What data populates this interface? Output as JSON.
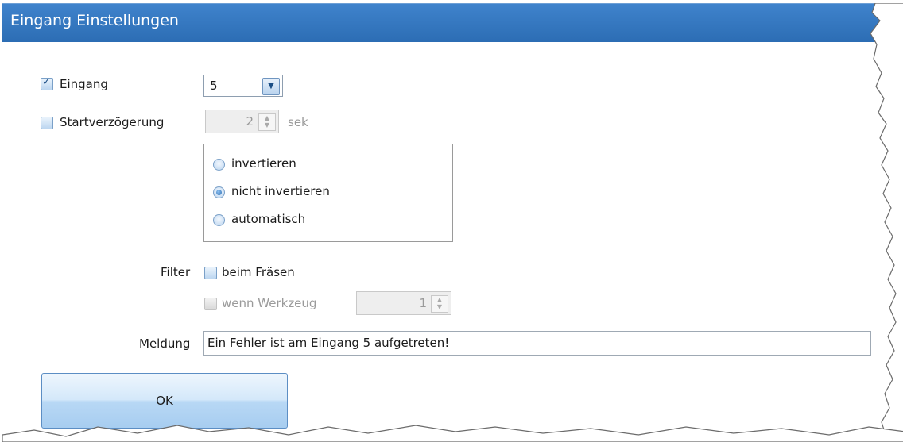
{
  "window": {
    "title": "Eingang Einstellungen"
  },
  "input": {
    "checkbox_label": "Eingang",
    "checked": true,
    "selected_value": "5"
  },
  "start_delay": {
    "checkbox_label": "Startverzögerung",
    "checked": false,
    "value": "2",
    "unit": "sek"
  },
  "invert_options": {
    "options": [
      "invertieren",
      "nicht invertieren",
      "automatisch"
    ],
    "selected": "nicht invertieren"
  },
  "filter": {
    "label": "Filter",
    "milling_label": "beim Fräsen",
    "milling_checked": false,
    "tool_label": "wenn Werkzeug",
    "tool_checked": false,
    "tool_value": "1"
  },
  "message": {
    "label": "Meldung",
    "value": "Ein Fehler ist am Eingang 5 aufgetreten!"
  },
  "ok_button": {
    "label": "OK"
  },
  "icons": [
    "check-icon",
    "chevron-down-icon",
    "spin-arrows-icon"
  ]
}
